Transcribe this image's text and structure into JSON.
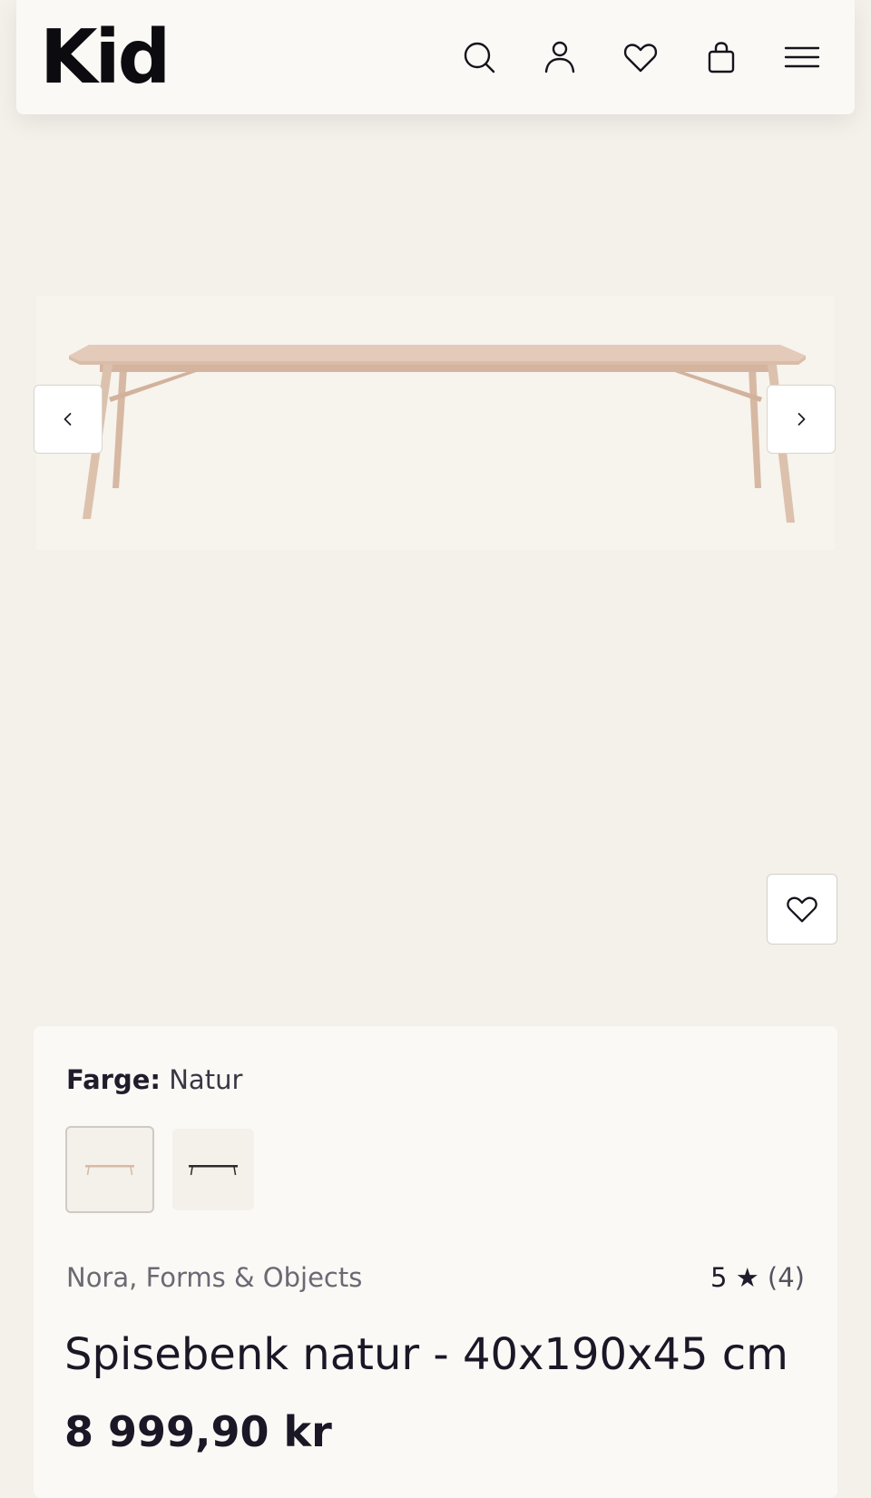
{
  "header": {
    "logo": "Kid",
    "icons": [
      "search-icon",
      "account-icon",
      "wishlist-icon",
      "cart-icon",
      "menu-icon"
    ]
  },
  "gallery": {
    "image_alt": "Spisebenk natur",
    "prev_icon": "chevron-left-icon",
    "next_icon": "chevron-right-icon",
    "wishlist_icon": "heart-icon"
  },
  "product": {
    "color_label": "Farge:",
    "color_value": "Natur",
    "swatches": [
      {
        "name": "natur",
        "selected": true,
        "color": "#d9b9a3"
      },
      {
        "name": "sort",
        "selected": false,
        "color": "#2c2a2b"
      }
    ],
    "brand": "Nora, Forms & Objects",
    "rating_value": "5",
    "rating_star": "★",
    "rating_count": "(4)",
    "title": "Spisebenk natur - 40x190x45 cm",
    "price": "8 999,90 kr"
  },
  "colors": {
    "background": "#f4f0ea",
    "card": "#fbf9f5",
    "wood": "#dcc0ab",
    "text": "#1a1726",
    "muted": "#6c6975"
  }
}
